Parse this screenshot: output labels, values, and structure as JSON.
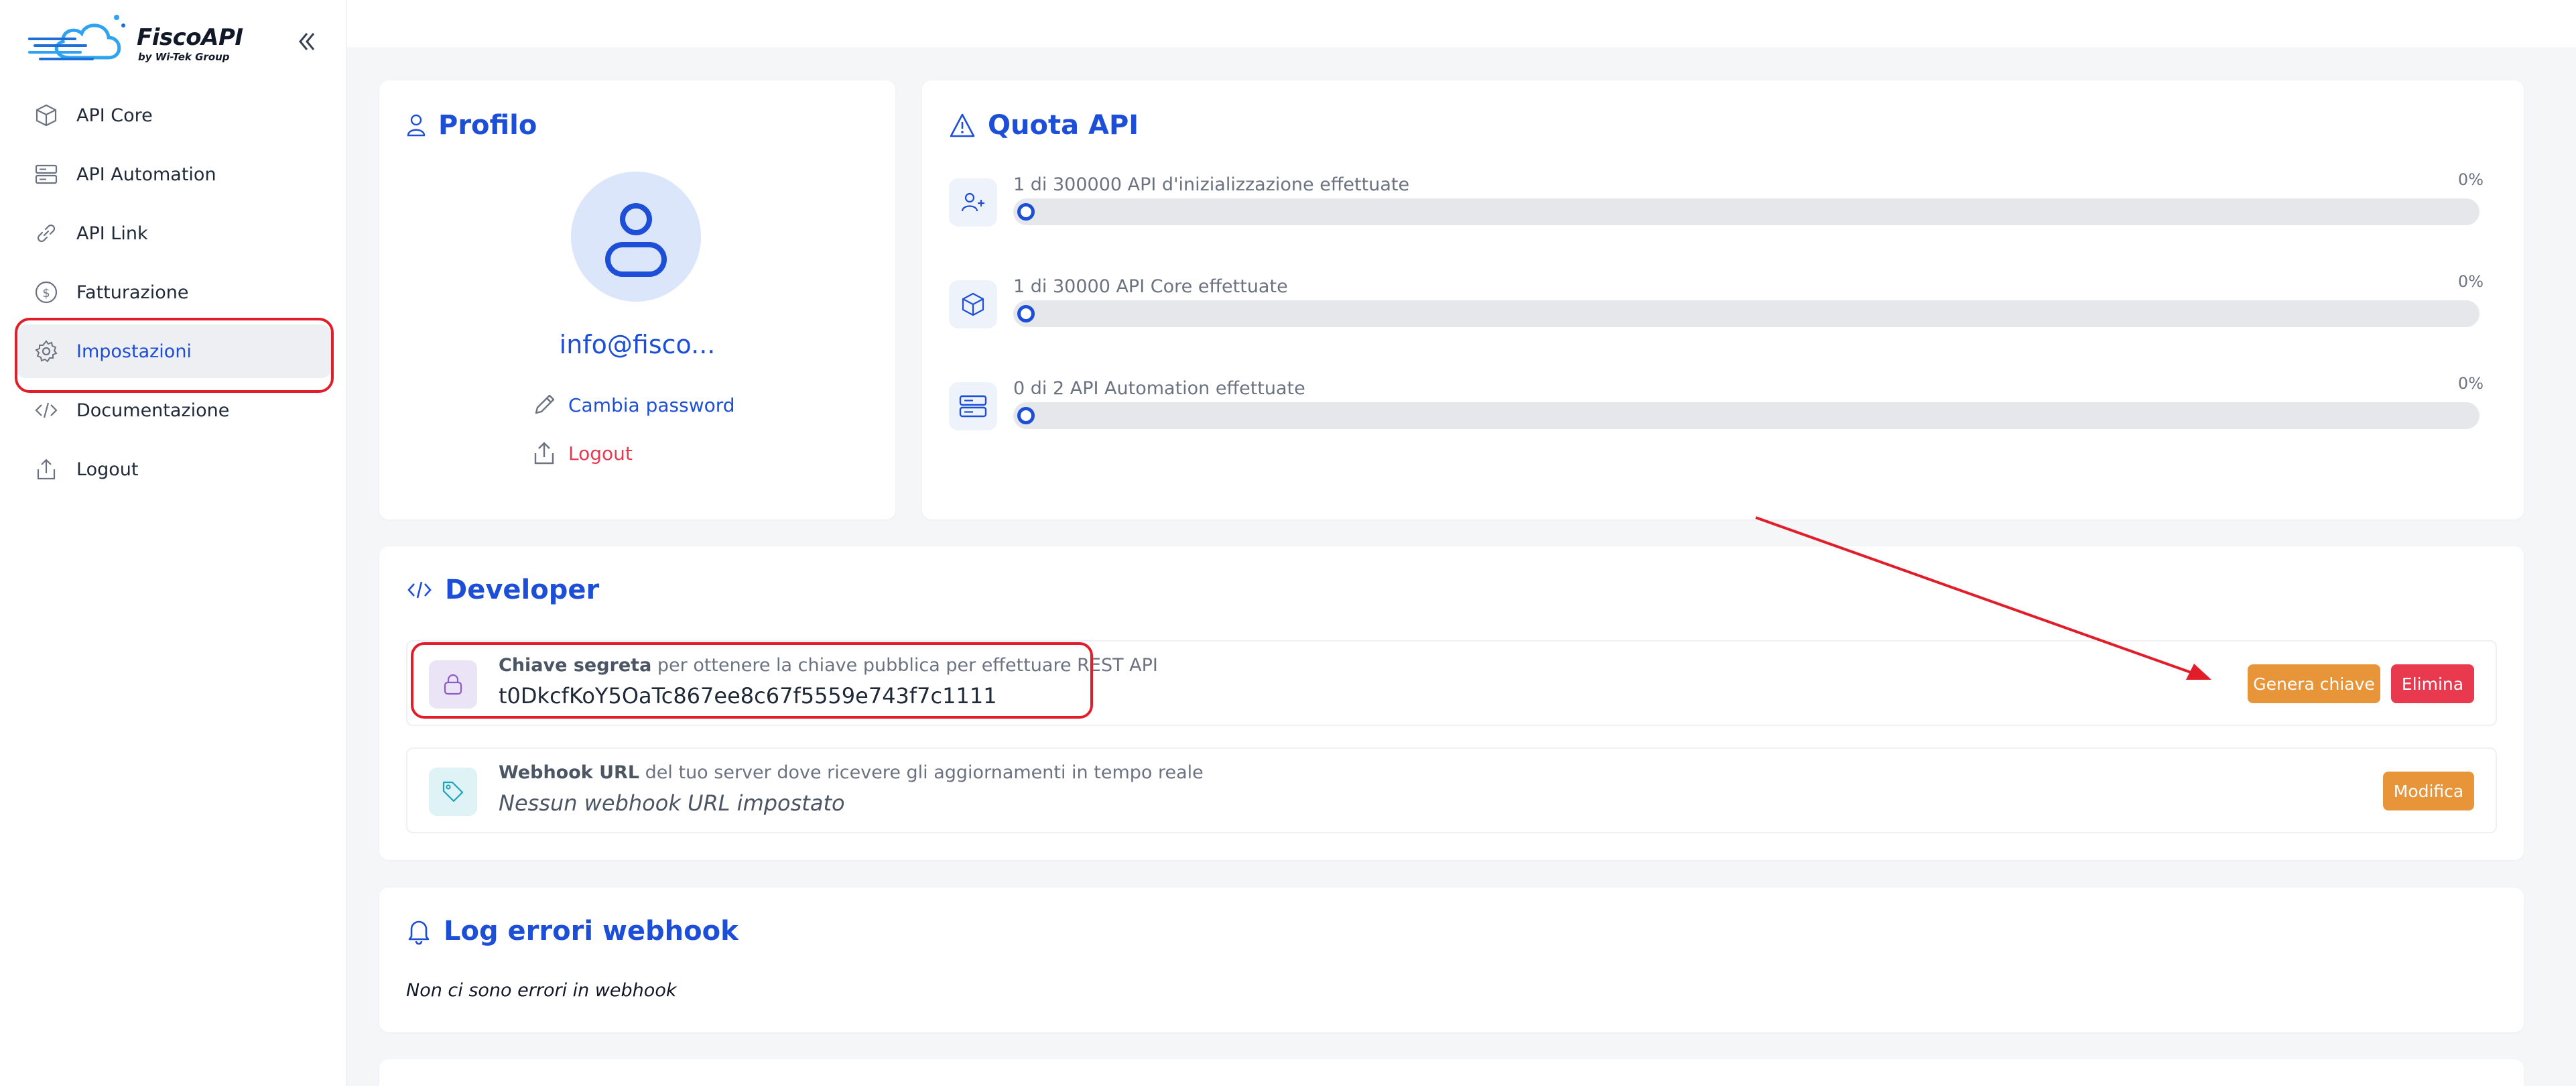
{
  "app": {
    "logo_title": "FiscoAPI",
    "logo_subtitle": "by Wi-Tek Group"
  },
  "sidebar": {
    "items": [
      {
        "label": "API Core",
        "icon": "cube-icon"
      },
      {
        "label": "API Automation",
        "icon": "server-icon"
      },
      {
        "label": "API Link",
        "icon": "link-icon"
      },
      {
        "label": "Fatturazione",
        "icon": "dollar-icon"
      },
      {
        "label": "Impostazioni",
        "icon": "gear-icon",
        "active": true
      },
      {
        "label": "Documentazione",
        "icon": "code-icon"
      },
      {
        "label": "Logout",
        "icon": "upload-icon"
      }
    ]
  },
  "profile": {
    "title": "Profilo",
    "email": "info@fisco...",
    "change_password": "Cambia password",
    "logout": "Logout"
  },
  "quota": {
    "title": "Quota API",
    "rows": [
      {
        "label": "1 di 300000 API d'inizializzazione effettuate",
        "percent": "0%",
        "progress": 0
      },
      {
        "label": "1 di 30000 API Core effettuate",
        "percent": "0%",
        "progress": 0
      },
      {
        "label": "0 di 2 API Automation effettuate",
        "percent": "0%",
        "progress": 0
      }
    ]
  },
  "developer": {
    "title": "Developer",
    "secret": {
      "caption_bold": "Chiave segreta",
      "caption_rest": " per ottenere la chiave pubblica per effettuare REST API",
      "value": "t0DkcfKoY5OaTc867ee8c67f5559e743f7c1111",
      "generate_label": "Genera chiave",
      "delete_label": "Elimina"
    },
    "webhook": {
      "caption_bold": "Webhook URL",
      "caption_rest": " del tuo server dove ricevere gli aggiornamenti in tempo reale",
      "value": "Nessun webhook URL impostato",
      "edit_label": "Modifica"
    }
  },
  "log": {
    "title": "Log errori webhook",
    "empty_text": "Non ci sono errori in webhook"
  },
  "colors": {
    "accent": "#1d4ed8",
    "highlight": "#e11d2a",
    "orange": "#e8953a",
    "red": "#e8394f"
  }
}
